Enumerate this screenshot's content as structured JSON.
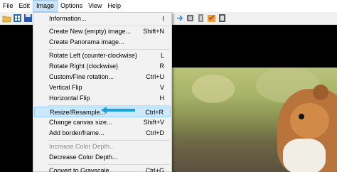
{
  "menubar": {
    "items": [
      {
        "label": "File"
      },
      {
        "label": "Edit"
      },
      {
        "label": "Image"
      },
      {
        "label": "Options"
      },
      {
        "label": "View"
      },
      {
        "label": "Help"
      }
    ]
  },
  "image_menu": {
    "items": [
      {
        "label": "Information...",
        "shortcut": "I"
      },
      {
        "label": "Create New (empty) image...",
        "shortcut": "Shift+N"
      },
      {
        "label": "Create Panorama image...",
        "shortcut": ""
      },
      {
        "label": "Rotate Left (counter-clockwise)",
        "shortcut": "L"
      },
      {
        "label": "Rotate Right (clockwise)",
        "shortcut": "R"
      },
      {
        "label": "Custom/Fine rotation...",
        "shortcut": "Ctrl+U"
      },
      {
        "label": "Vertical Flip",
        "shortcut": "V"
      },
      {
        "label": "Horizontal Flip",
        "shortcut": "H"
      },
      {
        "label": "Resize/Resample...",
        "shortcut": "Ctrl+R"
      },
      {
        "label": "Change canvas size...",
        "shortcut": "Shift+V"
      },
      {
        "label": "Add border/frame...",
        "shortcut": "Ctrl+D"
      },
      {
        "label": "Increase Color Depth...",
        "shortcut": ""
      },
      {
        "label": "Decrease Color Depth...",
        "shortcut": ""
      },
      {
        "label": "Convert to Grayscale",
        "shortcut": "Ctrl+G"
      }
    ]
  },
  "colors": {
    "highlight": "#cce8ff",
    "arrow": "#1ba1d9",
    "menu_bg": "#f2f2f2"
  },
  "icons": [
    "open-icon",
    "thumbnails-icon",
    "save-icon",
    "next-icon",
    "rotate-icon",
    "settings-icon",
    "info-icon"
  ]
}
